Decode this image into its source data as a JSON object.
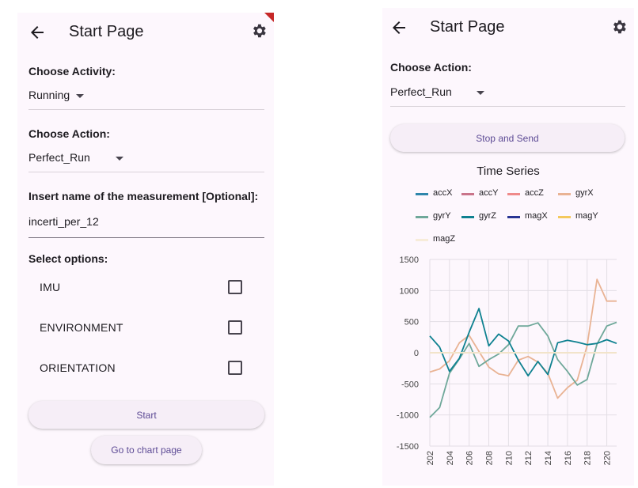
{
  "left": {
    "title": "Start Page",
    "activity_label": "Choose Activity:",
    "activity_value": "Running",
    "action_label": "Choose Action:",
    "action_value": "Perfect_Run",
    "measurement_label": "Insert name of the measurement [Optional]:",
    "measurement_value": "incerti_per_12",
    "options_label": "Select options:",
    "options": [
      {
        "label": "IMU",
        "checked": false
      },
      {
        "label": "ENVIRONMENT",
        "checked": false
      },
      {
        "label": "ORIENTATION",
        "checked": false
      }
    ],
    "start_button": "Start",
    "chart_page_button": "Go to chart page"
  },
  "right": {
    "title": "Start Page",
    "action_label": "Choose Action:",
    "action_value": "Perfect_Run",
    "stop_button": "Stop and Send",
    "icons": {
      "back": "back-arrow-icon",
      "settings": "gear-icon"
    }
  },
  "colors": {
    "background": "#fdf7fd",
    "button_bg": "#f6eef7",
    "button_text": "#5d4b95",
    "debug_banner": "#c62828"
  },
  "chart_data": {
    "type": "line",
    "title": "Time Series",
    "x": [
      202,
      203,
      204,
      205,
      206,
      207,
      208,
      209,
      210,
      211,
      212,
      213,
      214,
      215,
      216,
      217,
      218,
      219,
      220,
      221
    ],
    "x_tick_labels": [
      "202",
      "204",
      "206",
      "208",
      "210",
      "212",
      "214",
      "216",
      "218",
      "220"
    ],
    "ylim": [
      -1500,
      1500
    ],
    "y_ticks": [
      -1500,
      -1000,
      -500,
      0,
      500,
      1000,
      1500
    ],
    "grid": true,
    "legend_position": "top",
    "series": [
      {
        "name": "accX",
        "color": "#2e86ab",
        "values": [
          0,
          0,
          0,
          0,
          0,
          0,
          0,
          0,
          0,
          0,
          0,
          0,
          0,
          0,
          0,
          0,
          0,
          0,
          0,
          0
        ]
      },
      {
        "name": "accY",
        "color": "#c9748a",
        "values": [
          0,
          0,
          0,
          0,
          0,
          0,
          0,
          0,
          0,
          0,
          0,
          0,
          0,
          0,
          0,
          0,
          0,
          0,
          0,
          0
        ]
      },
      {
        "name": "accZ",
        "color": "#ef8a8a",
        "values": [
          0,
          0,
          0,
          0,
          0,
          0,
          0,
          0,
          0,
          0,
          0,
          0,
          0,
          0,
          0,
          0,
          0,
          0,
          0,
          0
        ]
      },
      {
        "name": "gyrX",
        "color": "#e9b394",
        "values": [
          -310,
          -260,
          -130,
          160,
          280,
          20,
          -230,
          -340,
          -370,
          -120,
          -60,
          -150,
          -330,
          -730,
          -560,
          -440,
          110,
          1180,
          830,
          830
        ]
      },
      {
        "name": "gyrY",
        "color": "#6fa89a",
        "values": [
          -1040,
          -880,
          -330,
          -100,
          150,
          -220,
          -110,
          -20,
          130,
          430,
          430,
          480,
          270,
          -110,
          -300,
          -520,
          -430,
          140,
          430,
          490
        ]
      },
      {
        "name": "gyrZ",
        "color": "#0e8190",
        "values": [
          270,
          90,
          -300,
          -90,
          330,
          710,
          110,
          300,
          190,
          -120,
          -370,
          -140,
          -350,
          160,
          200,
          170,
          130,
          150,
          210,
          150
        ]
      },
      {
        "name": "magX",
        "color": "#283593",
        "values": [
          0,
          0,
          0,
          0,
          0,
          0,
          0,
          0,
          0,
          0,
          0,
          0,
          0,
          0,
          0,
          0,
          0,
          0,
          0,
          0
        ]
      },
      {
        "name": "magY",
        "color": "#f4c95d",
        "values": [
          0,
          0,
          0,
          0,
          0,
          0,
          0,
          0,
          0,
          0,
          0,
          0,
          0,
          0,
          0,
          0,
          0,
          0,
          0,
          0
        ]
      },
      {
        "name": "magZ",
        "color": "#f7ecd9",
        "values": [
          0,
          0,
          0,
          0,
          0,
          0,
          0,
          0,
          0,
          0,
          0,
          0,
          0,
          0,
          0,
          0,
          0,
          0,
          0,
          0
        ]
      }
    ]
  }
}
